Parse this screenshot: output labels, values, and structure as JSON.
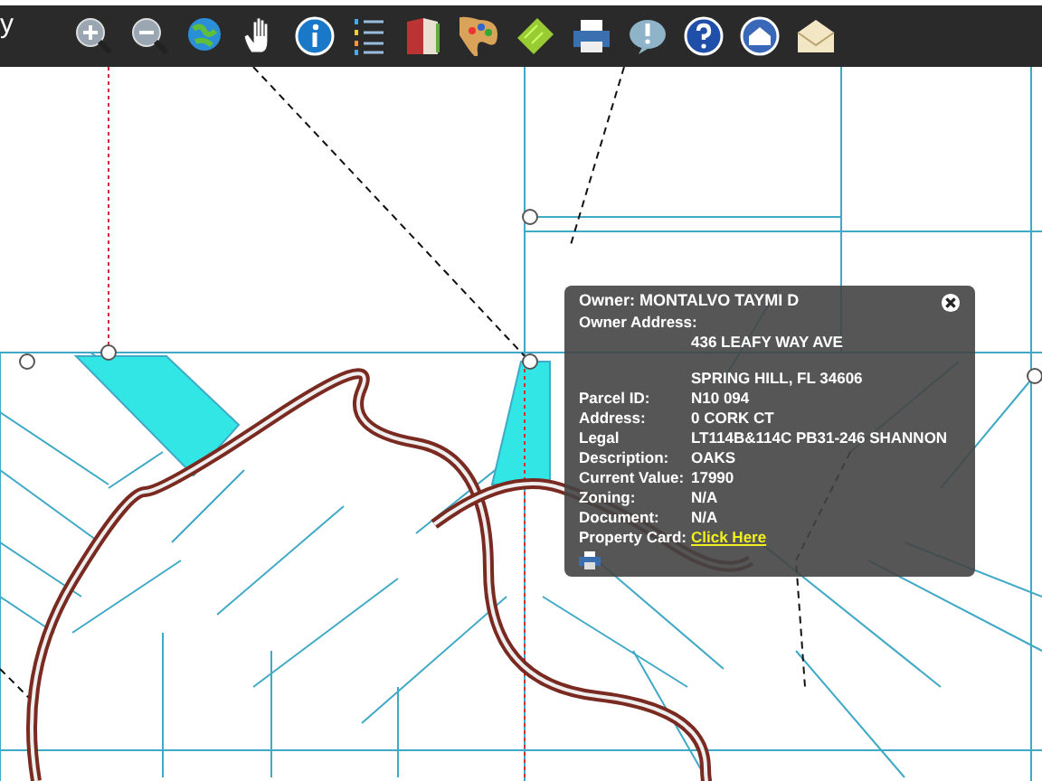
{
  "toolbar": {
    "title_fragment": "y"
  },
  "popup": {
    "title": "Owner: MONTALVO TAYMI D",
    "fields": [
      {
        "label": "Owner Address:",
        "kind": "heading"
      },
      {
        "value": "436 LEAFY WAY AVE",
        "kind": "line"
      },
      {
        "value": "SPRING HILL, FL 34606",
        "kind": "gapline"
      },
      {
        "label": "Parcel ID:",
        "value": "N10 094",
        "kind": "pair"
      },
      {
        "label": "Address:",
        "value": "0 CORK CT",
        "kind": "pair"
      },
      {
        "label": "Legal Description:",
        "value": "LT114B&114C PB31-246 SHANNON OAKS",
        "kind": "pair"
      },
      {
        "label": "Current Value:",
        "value": "17990",
        "kind": "pair"
      },
      {
        "label": "Zoning:",
        "value": "N/A",
        "kind": "pair"
      },
      {
        "label": "Document:",
        "value": "N/A",
        "kind": "pair"
      },
      {
        "label": "Property Card:",
        "value": "Click Here",
        "kind": "link"
      }
    ]
  }
}
